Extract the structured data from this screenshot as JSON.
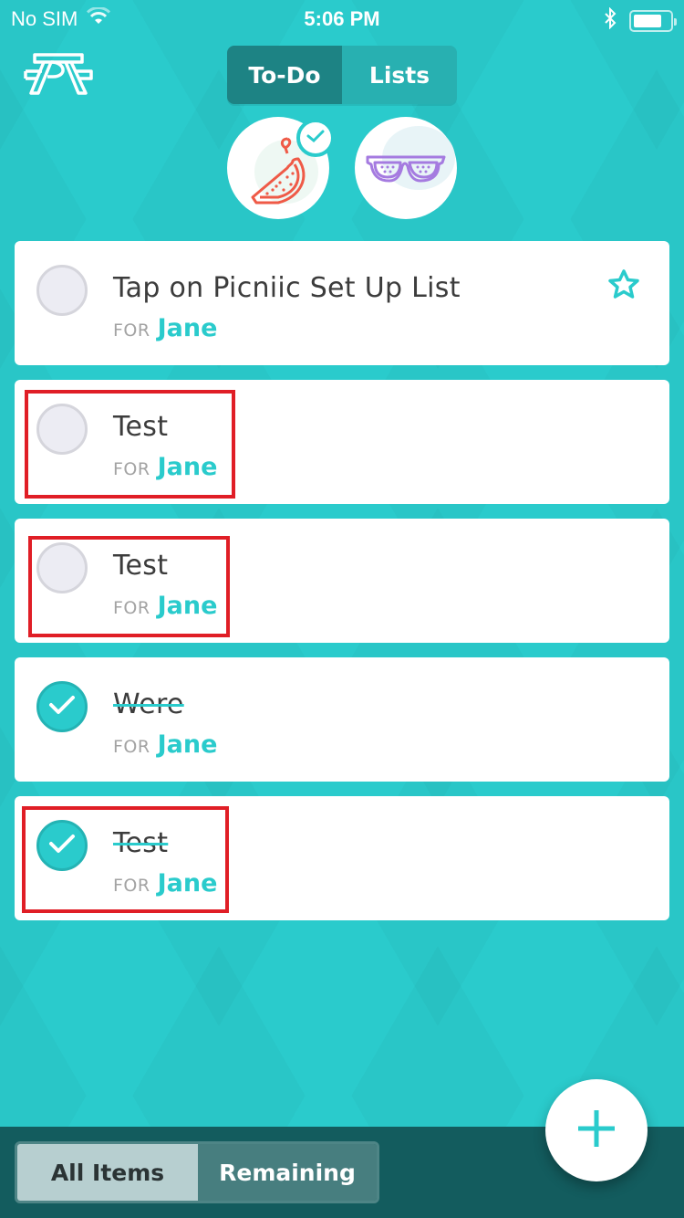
{
  "status_bar": {
    "carrier": "No SIM",
    "time": "5:06 PM",
    "wifi_icon": "wifi-icon",
    "bluetooth_icon": "bluetooth-icon",
    "battery_icon": "battery-icon"
  },
  "header": {
    "logo_icon": "picnic-table-logo-icon",
    "tabs": [
      {
        "label": "To-Do",
        "active": true
      },
      {
        "label": "Lists",
        "active": false
      }
    ]
  },
  "lists": [
    {
      "name": "watermelon",
      "icon": "watermelon-icon",
      "selected": true
    },
    {
      "name": "sunglasses",
      "icon": "sunglasses-icon",
      "selected": false
    }
  ],
  "tasks": [
    {
      "title": "Tap on Picniic Set Up List",
      "for_label": "FOR",
      "assignee": "Jane",
      "done": false,
      "starred": false,
      "highlighted": false
    },
    {
      "title": "Test",
      "for_label": "FOR",
      "assignee": "Jane",
      "done": false,
      "starred": false,
      "highlighted": true
    },
    {
      "title": "Test",
      "for_label": "FOR",
      "assignee": "Jane",
      "done": false,
      "starred": false,
      "highlighted": true
    },
    {
      "title": "Were",
      "for_label": "FOR",
      "assignee": "Jane",
      "done": true,
      "starred": false,
      "highlighted": false
    },
    {
      "title": "Test",
      "for_label": "FOR",
      "assignee": "Jane",
      "done": true,
      "starred": false,
      "highlighted": true
    }
  ],
  "footer": {
    "filters": [
      {
        "label": "All Items",
        "active": true
      },
      {
        "label": "Remaining",
        "active": false
      }
    ],
    "add_button_icon": "plus-icon"
  },
  "colors": {
    "accent": "#2acbcc",
    "accent_dark": "#1d8384",
    "footer_bg": "#135c5e",
    "highlight": "#e01e26",
    "watermelon": "#ef5a47",
    "sunglasses": "#a57be0"
  }
}
